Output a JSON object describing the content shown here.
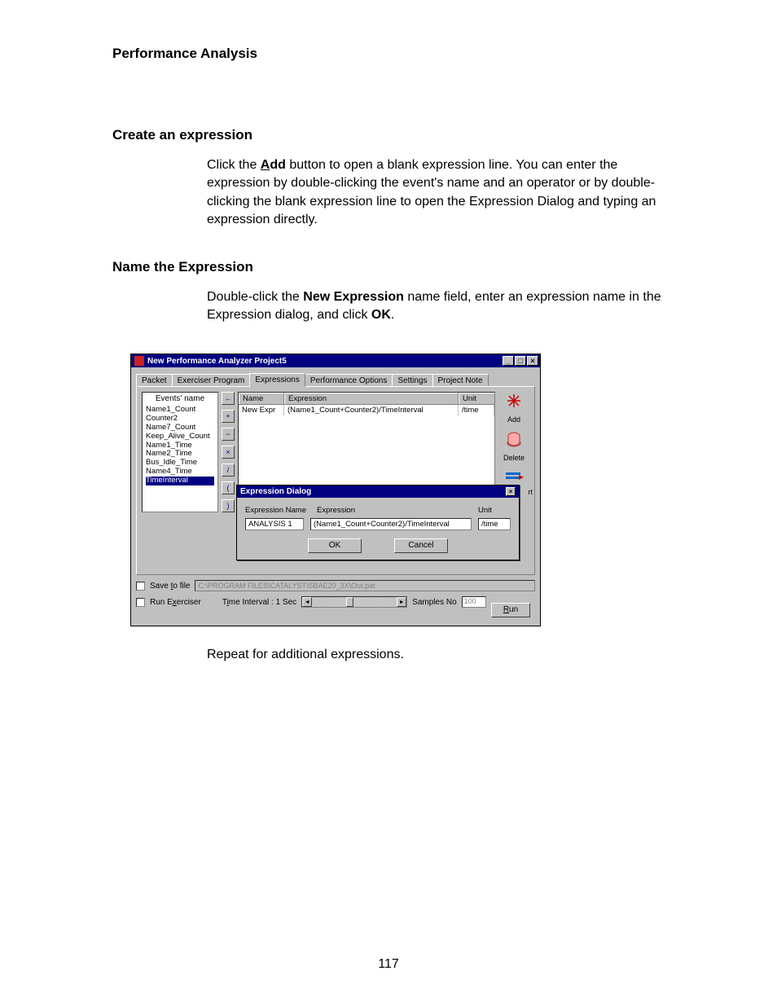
{
  "doc": {
    "section_title": "Performance Analysis",
    "h_create": "Create an expression",
    "p_create_before_add": "Click the ",
    "p_create_add_word": "Add",
    "p_create_after_add": " button to open a blank expression line. You can enter the expression by double-clicking the event's name and an operator or by double-clicking the blank expression line to open the Expression Dialog and typing an expression directly.",
    "h_name": "Name the Expression",
    "p_name_before_newexpr": "Double-click the ",
    "p_name_newexpr": "New Expression",
    "p_name_middle": " name field, enter an expression name in the Expression dialog, and click ",
    "p_name_ok": "OK",
    "p_name_after": ".",
    "p_repeat": "Repeat for additional expressions.",
    "page_number": "117"
  },
  "win": {
    "title": "New Performance Analyzer Project5",
    "tabs": [
      "Packet",
      "Exerciser Program",
      "Expressions",
      "Performance Options",
      "Settings",
      "Project Note"
    ],
    "active_tab_index": 2,
    "events_title": "Events' name",
    "events": [
      "Name1_Count",
      "Counter2",
      "Name7_Count",
      "Keep_Alive_Count",
      "Name1_Time",
      "Name2_Time",
      "Bus_Idle_Time",
      "Name4_Time",
      "TimeInterval"
    ],
    "events_selected_index": 8,
    "vbtn_glyphs": [
      "←",
      "+",
      "−",
      "×",
      "/",
      "(",
      ")"
    ],
    "grid_headers": {
      "name": "Name",
      "expr": "Expression",
      "unit": "Unit"
    },
    "grid_rows": [
      {
        "name": "New Expr",
        "expr": "(Name1_Count+Counter2)/TimeInterval",
        "unit": "/time"
      }
    ],
    "actions": {
      "add": "Add",
      "delete": "Delete"
    },
    "partial_label_fragment": "rt",
    "dialog": {
      "title": "Expression Dialog",
      "col_name": "Expression Name",
      "col_expr": "Expression",
      "col_unit": "Unit",
      "val_name": "ANALYSIS 1",
      "val_expr": "(Name1_Count+Counter2)/TimeInterval",
      "val_unit": "/time",
      "ok": "OK",
      "cancel": "Cancel"
    },
    "bottom": {
      "save_to_file_prefix": "S",
      "save_to_file_rest": "ave to file",
      "save_to_file_underline": "t",
      "path": "C:\\PROGRAM FILES\\CATALYST\\SBAE20_3X\\Out.pat",
      "run_exerciser_rest": "Run E",
      "run_exerciser_underline": "x",
      "run_exerciser_rest2": "erciser",
      "time_interval_prefix": "T",
      "time_interval_underline": "i",
      "time_interval_rest": "me Interval : 1 Sec",
      "samples_no": "Samples No",
      "samples_val": "100",
      "run_btn_underline": "R",
      "run_btn_rest": "un"
    }
  }
}
